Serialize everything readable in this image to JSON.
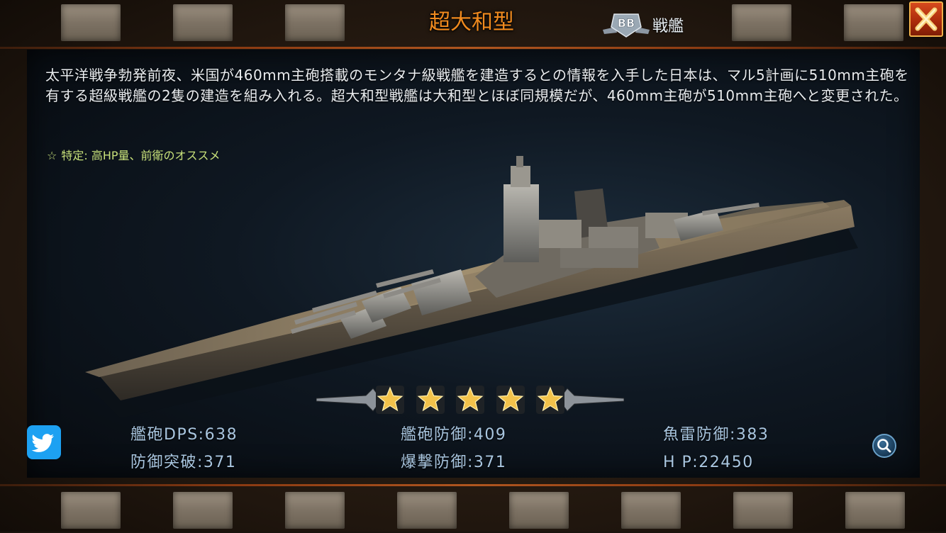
{
  "header": {
    "title": "超大和型",
    "type_badge": "BB",
    "type_label": "戦艦",
    "close_icon": "close-x-icon"
  },
  "description": "太平洋戦争勃発前夜、米国が460mm主砲搭載のモンタナ級戦艦を建造するとの情報を入手した日本は、マル5計画に510mm主砲を有する超級戦艦の2隻の建造を組み入れる。超大和型戦艦は大和型とほぼ同規模だが、460mm主砲が510mm主砲へと変更された。",
  "trait": "特定: 高HP量、前衛のオススメ",
  "rating": {
    "stars": 5,
    "max": 5
  },
  "stats": {
    "gun_dps": "艦砲DPS:638",
    "gun_defense": "艦砲防御:409",
    "torpedo_defense": "魚雷防御:383",
    "defense_break": "防御突破:371",
    "bomb_defense": "爆撃防御:371",
    "hp": "H P:22450"
  },
  "colors": {
    "title": "#f08a1e",
    "stat_text": "#a9c6e0",
    "trait_text": "#c7e07a",
    "frame_accent": "#b0561f",
    "close_button": "#c23a12",
    "twitter": "#1da1f2"
  },
  "icons": {
    "share": "twitter-icon",
    "zoom": "magnifier-icon",
    "trait": "star-outline-icon",
    "rank": "gold-star-icon"
  }
}
